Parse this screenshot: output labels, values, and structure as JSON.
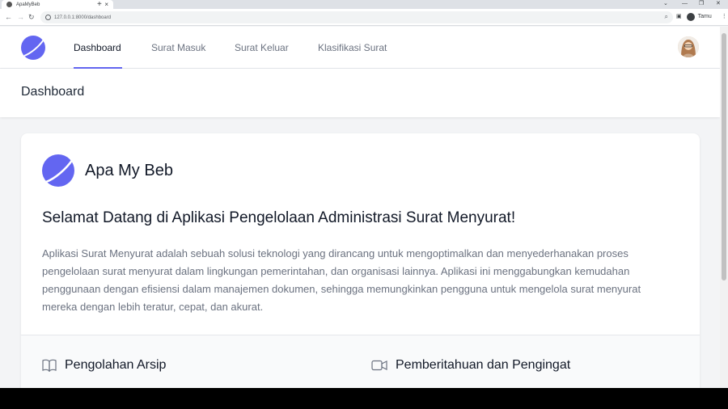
{
  "browser": {
    "tab_title": "ApaMyBeb",
    "tab_close": "×",
    "new_tab": "+",
    "url": "127.0.0.1:8000/dashboard",
    "profile_label": "Tamu"
  },
  "nav": {
    "items": [
      {
        "label": "Dashboard",
        "active": true
      },
      {
        "label": "Surat Masuk",
        "active": false
      },
      {
        "label": "Surat Keluar",
        "active": false
      },
      {
        "label": "Klasifikasi Surat",
        "active": false
      }
    ]
  },
  "header": {
    "title": "Dashboard"
  },
  "card": {
    "brand": "Apa My Beb",
    "welcome": "Selamat Datang di Aplikasi Pengelolaan Administrasi Surat Menyurat!",
    "description": "Aplikasi Surat Menyurat adalah sebuah solusi teknologi yang dirancang untuk mengoptimalkan dan menyederhanakan proses pengelolaan surat menyurat dalam lingkungan pemerintahan, dan organisasi lainnya. Aplikasi ini menggabungkan kemudahan penggunaan dengan efisiensi dalam manajemen dokumen, sehingga memungkinkan pengguna untuk mengelola surat menyurat mereka dengan lebih teratur, cepat, dan akurat.",
    "features": [
      {
        "title": "Pengolahan Arsip",
        "icon": "book-icon"
      },
      {
        "title": "Pemberitahuan dan Pengingat",
        "icon": "video-icon"
      }
    ]
  },
  "colors": {
    "accent": "#6366f1",
    "logo": "#6366f1"
  }
}
